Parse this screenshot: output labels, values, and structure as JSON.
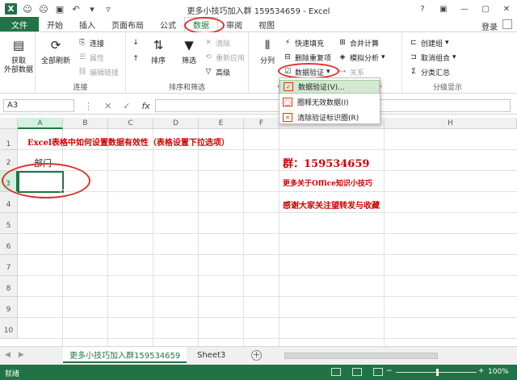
{
  "window": {
    "title": "更多小技巧加入群 159534659 - Excel",
    "login": "登录",
    "help": "?"
  },
  "tabs": [
    "文件",
    "开始",
    "插入",
    "页面布局",
    "公式",
    "数据",
    "审阅",
    "视图"
  ],
  "active_tab": "数据",
  "ribbon": {
    "get_external": "获取\n外部数据",
    "refresh_all": "全部刷新",
    "connections": "连接",
    "properties": "属性",
    "edit_links": "编辑链接",
    "group_connections": "连接",
    "sort": "排序",
    "filter": "筛选",
    "clear": "清除",
    "reapply": "重新应用",
    "advanced": "高级",
    "group_sort_filter": "排序和筛选",
    "text_to_columns": "分列",
    "flash_fill": "快速填充",
    "remove_duplicates": "删除重复项",
    "data_validation": "数据验证",
    "consolidate": "合并计算",
    "what_if": "模拟分析",
    "relationships": "关系",
    "group_outline": "创建组",
    "ungroup": "取消组合",
    "subtotal": "分类汇总",
    "group_outline_label": "分级显示"
  },
  "dropdown": {
    "items": [
      "数据验证(V)...",
      "圈释无效数据(I)",
      "清除验证标识圈(R)"
    ]
  },
  "formula_bar": {
    "name_box": "A3",
    "fx": "fx"
  },
  "grid": {
    "columns": [
      "A",
      "B",
      "C",
      "D",
      "E",
      "F",
      "",
      "H"
    ],
    "rows": [
      "1",
      "2",
      "3",
      "4",
      "5",
      "6",
      "7",
      "8",
      "9",
      "10"
    ],
    "a1_title": "Excel表格中如何设置数据有效性（表格设置下拉选项）",
    "a2_value": "部门",
    "group_text": "群：159534659",
    "more_tips": "更多关于Office知识小技巧",
    "thanks": "感谢大家关注望转发与收藏"
  },
  "sheets": {
    "active": "更多小技巧加入群159534659",
    "other": "Sheet3"
  },
  "status": {
    "ready": "就绪",
    "zoom": "100%"
  },
  "colors": {
    "excel_green": "#217346",
    "annotation_red": "#e0302a",
    "text_red": "#d00000"
  }
}
